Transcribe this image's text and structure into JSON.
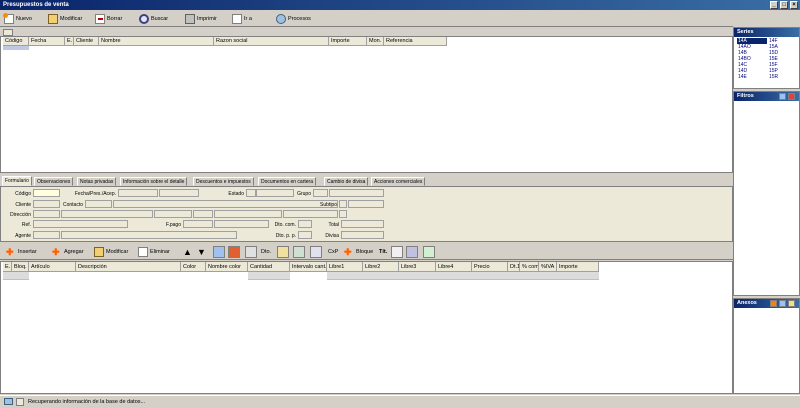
{
  "window": {
    "title": "Presupuestos de venta"
  },
  "toolbar": {
    "buttons": [
      {
        "label": "Nuevo",
        "icon": "new-doc-icon"
      },
      {
        "label": "Modificar",
        "icon": "edit-icon"
      },
      {
        "label": "Borrar",
        "icon": "delete-icon"
      },
      {
        "label": "Buscar",
        "icon": "search-icon"
      },
      {
        "label": "Imprimir",
        "icon": "print-icon"
      },
      {
        "label": "Ir a",
        "icon": "goto-icon"
      },
      {
        "label": "Procesos",
        "icon": "process-icon"
      }
    ]
  },
  "top_grid": {
    "columns": [
      "Código",
      "Fecha",
      "E.",
      "Cliente",
      "Nombre",
      "Razon social",
      "Importe",
      "Mon.",
      "Referencia"
    ]
  },
  "tabs": [
    "Formulario",
    "Observaciones",
    "Notas privadas",
    "Información sobre el detalle",
    "Descuentos e impuestos",
    "Documentos en cartera",
    "Cambio de divisa",
    "Acciones comerciales"
  ],
  "form": {
    "codigo": "Código",
    "fecha": "Fecha/Pres./Acep.",
    "estado": "Estado",
    "grupo": "Grupo",
    "cliente": "Cliente",
    "contacto": "Contacto",
    "subtipo": "Subtipo",
    "direccion": "Dirección",
    "ref": "Ref.",
    "fpago": "F.pago",
    "dtocom": "Dto. com.",
    "total": "Total",
    "agente": "Agente",
    "dtopp": "Dto. p. p.",
    "divisa": "Divisa"
  },
  "lines_toolbar": {
    "insertar": "Insertar",
    "agregar": "Agregar",
    "modificar": "Modificar",
    "eliminar": "Eliminar",
    "dto": "Dto.",
    "cxp": "CxP",
    "bloque": "Bloque",
    "tit": "Tít."
  },
  "bottom_grid": {
    "columns": [
      "E.",
      "Bloq.",
      "Artículo",
      "Descripción",
      "Color",
      "Nombre color",
      "Cantidad",
      "Intervalo cant.",
      "Libre1",
      "Libre2",
      "Libre3",
      "Libre4",
      "Precio",
      "Dt.1",
      "% com",
      "%IVA",
      "Importe"
    ]
  },
  "series_panel": {
    "title": "Series",
    "col1": [
      "14A",
      "14AO",
      "14B",
      "14BO",
      "14C",
      "14D",
      "14E"
    ],
    "col2": [
      "14F",
      "15A",
      "15D",
      "15E",
      "15F",
      "15P",
      "15R"
    ]
  },
  "filtros_panel": {
    "title": "Filtros"
  },
  "anexos_panel": {
    "title": "Anexos"
  },
  "status": {
    "text": "Recuperando información de la base de datos..."
  },
  "colors": {
    "title_bar": "#0a246a",
    "selected_series": "#0a246a"
  }
}
